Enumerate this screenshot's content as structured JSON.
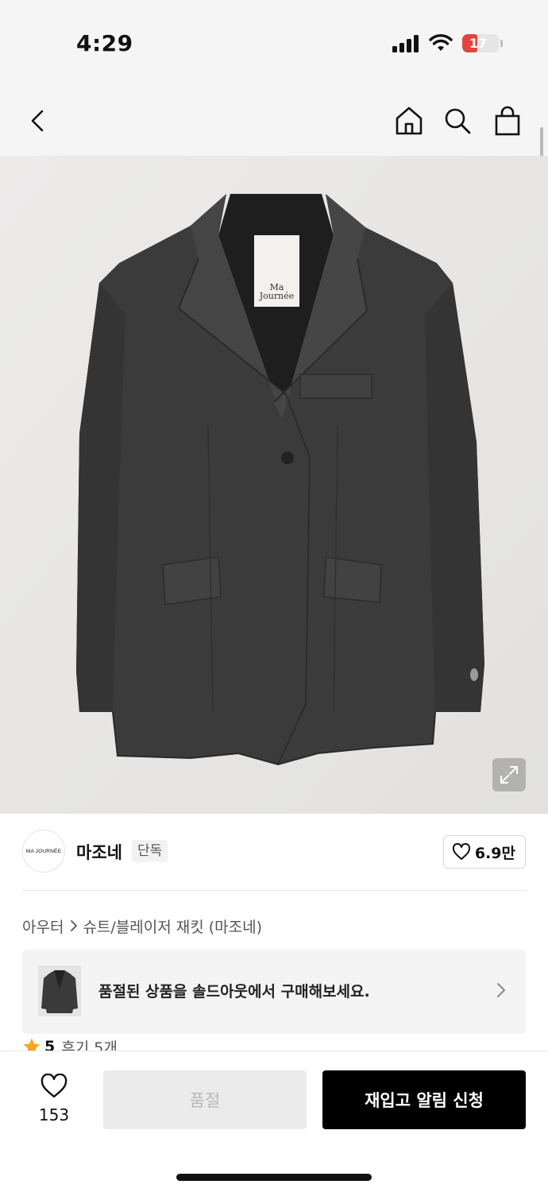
{
  "status_bar": {
    "time": "4:29",
    "battery": "17",
    "battery_level": 0.17,
    "battery_color": "#e0463e"
  },
  "nav": {
    "back_icon": "chevron-left-icon",
    "home_icon": "home-icon",
    "search_icon": "search-icon",
    "cart_icon": "shopping-bag-icon"
  },
  "product_image": {
    "label_line1": "Ma",
    "label_line2": "Journée",
    "expand_icon": "expand-icon"
  },
  "brand": {
    "logo_text": "MA JOURNÉE",
    "name": "마조네",
    "badge": "단독",
    "like_count": "6.9만"
  },
  "breadcrumb": {
    "category": "아우터",
    "product": "슈트/블레이저 재킷 (마조네)"
  },
  "soldout_banner": {
    "text": "품절된 상품을 솔드아웃에서 구매해보세요."
  },
  "rating": {
    "score": "5",
    "reviews": "후기 5개",
    "star_color": "#f5a623"
  },
  "bottom_bar": {
    "wish_count": "153",
    "soldout_label": "품절",
    "restock_label": "재입고 알림 신청"
  }
}
